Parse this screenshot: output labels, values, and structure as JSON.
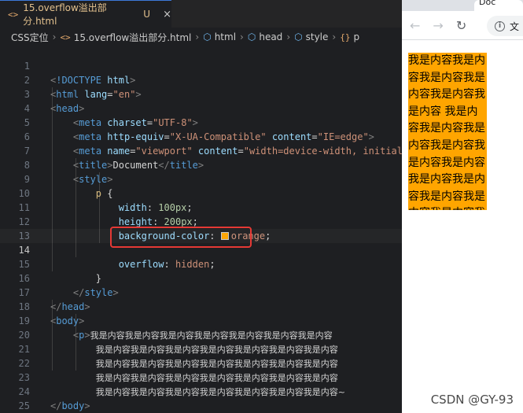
{
  "editor": {
    "tab": {
      "icon": "<>",
      "name": "15.overflow溢出部分.html",
      "modified": "U",
      "close": "×"
    },
    "breadcrumb": {
      "folder": "CSS定位",
      "file": "15.overflow溢出部分.html",
      "items": [
        "html",
        "head",
        "style",
        "p"
      ]
    },
    "line_numbers": [
      "1",
      "2",
      "3",
      "4",
      "5",
      "6",
      "7",
      "8",
      "9",
      "10",
      "11",
      "12",
      "13",
      "14",
      "15",
      "16",
      "17",
      "18",
      "19",
      "20",
      "21",
      "22",
      "23",
      "24",
      "25"
    ],
    "active_line": "14",
    "code": {
      "doctype": "!DOCTYPE",
      "html_kw": "html",
      "lang_attr": "lang",
      "lang_val": "\"en\"",
      "meta_charset_attr": "charset",
      "meta_charset_val": "\"UTF-8\"",
      "http_equiv_attr": "http-equiv",
      "http_equiv_val": "\"X-UA-Compatible\"",
      "content_attr": "content",
      "content_val": "\"IE=edge\"",
      "name_attr": "name",
      "name_val": "\"viewport\"",
      "viewport_content_val": "\"width=device-width, initial",
      "title_text": "Document",
      "selector": "p",
      "width_prop": "width",
      "width_val": "100px",
      "height_prop": "height",
      "height_val": "200px",
      "bg_prop": "background-color",
      "bg_val": "orange",
      "overflow_prop": "overflow",
      "overflow_val": "hidden",
      "p_line1": "我是内容我是内容我是内容我是内容我是内容我是内容我是内容",
      "p_line2": "我是内容我是内容我是内容我是内容我是内容我是内容我是内容",
      "p_line3": "我是内容我是内容我是内容我是内容我是内容我是内容我是内容",
      "p_line4": "我是内容我是内容我是内容我是内容我是内容我是内容我是内容",
      "p_line5": "我是内容我是内容我是内容我是内容我是内容我是内容我是内容~"
    }
  },
  "browser": {
    "tab_title": "Doc",
    "url": "文",
    "paragraph": "我是内容我是内容我是内容我是内容我是内容我是内容 我是内容我是内容我是内容我是内容我是内容我是内容我是内容我是内容我是内容我是内容我是内容我是内容我是内容我是内容"
  },
  "watermark": "CSDN @GY-93",
  "colors": {
    "editor_bg": "#1e1f22",
    "highlight_border": "#e53935",
    "orange": "#ffa500"
  }
}
